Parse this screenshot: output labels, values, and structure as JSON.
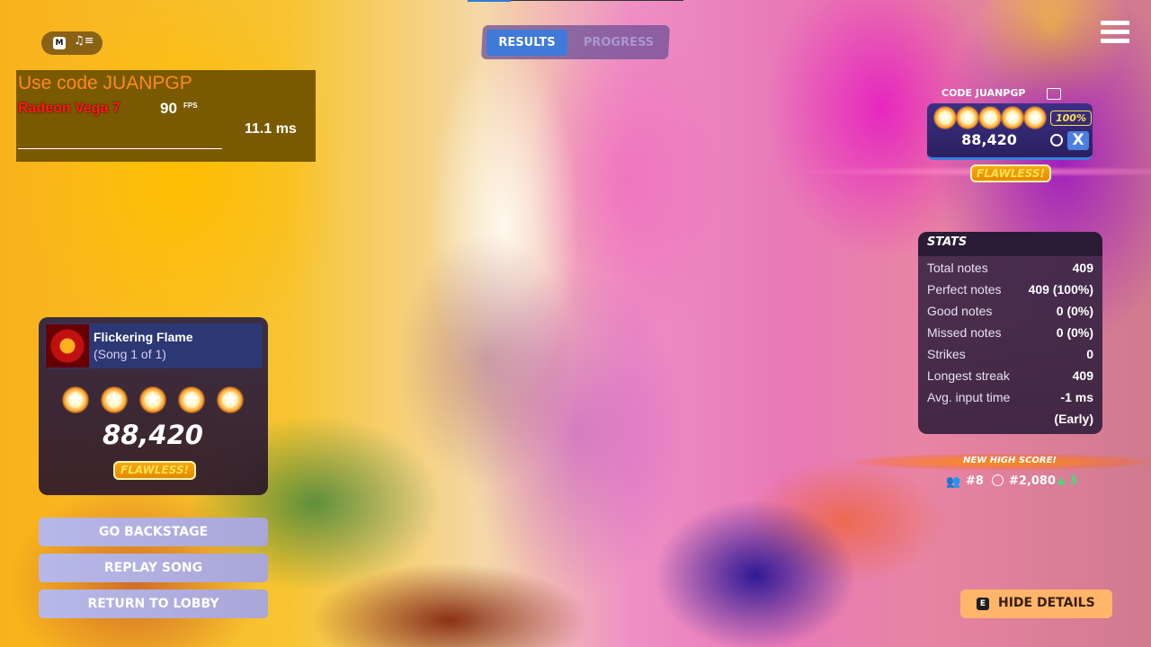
{
  "tabs": {
    "results": "RESULTS",
    "progress": "PROGRESS"
  },
  "hud": {
    "m_key": "M",
    "music_icon": "music-queue-icon"
  },
  "overlay": {
    "code": "Use code JUANPGP",
    "gpu": "Radeon Vega 7",
    "fps": "90",
    "fps_unit": "FPS",
    "frame_time": "11.1 ms"
  },
  "song": {
    "title": "Flickering Flame",
    "subtitle": "(Song 1 of 1)",
    "stars": 5,
    "score": "88,420",
    "badge": "FLAWLESS!"
  },
  "buttons": {
    "backstage": "GO BACKSTAGE",
    "replay": "REPLAY SONG",
    "lobby": "RETURN TO LOBBY"
  },
  "player": {
    "code": "CODE JUANPGP",
    "stars": 5,
    "accuracy": "100%",
    "score": "88,420",
    "instrument": "X",
    "badge": "FLAWLESS!"
  },
  "stats": {
    "title": "STATS",
    "rows": [
      {
        "label": "Total notes",
        "value": "409"
      },
      {
        "label": "Perfect notes",
        "value": "409 (100%)"
      },
      {
        "label": "Good notes",
        "value": "0 (0%)"
      },
      {
        "label": "Missed notes",
        "value": "0 (0%)"
      },
      {
        "label": "Strikes",
        "value": "0"
      },
      {
        "label": "Longest streak",
        "value": "409"
      },
      {
        "label": "Avg. input time",
        "value": "-1 ms"
      },
      {
        "label": "",
        "value": "(Early)"
      }
    ]
  },
  "highscore": {
    "label": "NEW HIGH SCORE!",
    "friends_rank": "#8",
    "global_rank": "#2,080",
    "rank_change": "3"
  },
  "footer": {
    "e_key": "E",
    "hide_details": "HIDE DETAILS"
  },
  "colors": {
    "accent": "#3f7ad8",
    "gold": "#ffe050",
    "positive": "#3fe07a"
  }
}
